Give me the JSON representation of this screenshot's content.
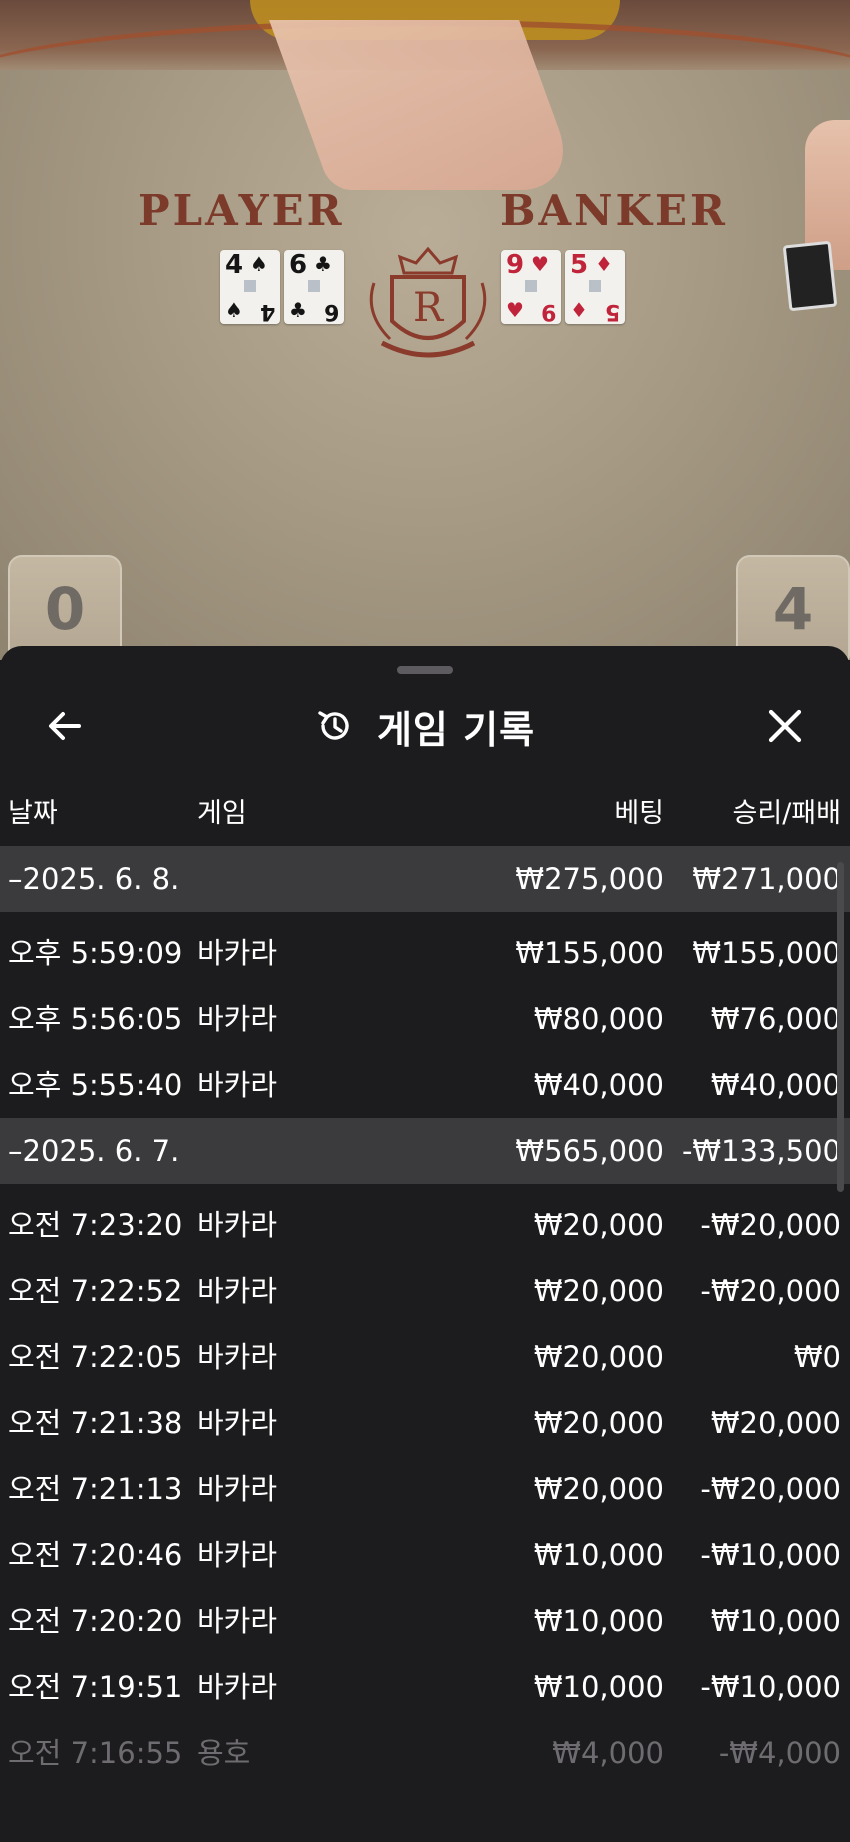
{
  "table": {
    "player_label": "PLAYER",
    "banker_label": "BANKER",
    "crest_letter": "R",
    "player_score": "0",
    "banker_score": "4",
    "player_cards": [
      {
        "rank": "4",
        "suit": "♠",
        "color": "#151515"
      },
      {
        "rank": "6",
        "suit": "♣",
        "color": "#151515"
      }
    ],
    "banker_cards": [
      {
        "rank": "9",
        "suit": "♥",
        "color": "#c0243a"
      },
      {
        "rank": "5",
        "suit": "♦",
        "color": "#c0243a"
      }
    ]
  },
  "sheet": {
    "title": "게임 기록",
    "back_icon": "arrow-left-icon",
    "history_icon": "history-clock-icon",
    "close_icon": "close-icon",
    "columns": {
      "date": "날짜",
      "game": "게임",
      "bet": "베팅",
      "result": "승리/패배"
    },
    "groups": [
      {
        "date": "–2025. 6. 8.",
        "bet": "₩275,000",
        "result": "₩271,000",
        "rows": [
          {
            "time": "오후 5:59:09",
            "game": "바카라",
            "bet": "₩155,000",
            "result": "₩155,000"
          },
          {
            "time": "오후 5:56:05",
            "game": "바카라",
            "bet": "₩80,000",
            "result": "₩76,000"
          },
          {
            "time": "오후 5:55:40",
            "game": "바카라",
            "bet": "₩40,000",
            "result": "₩40,000"
          }
        ]
      },
      {
        "date": "–2025. 6. 7.",
        "bet": "₩565,000",
        "result": "-₩133,500",
        "rows": [
          {
            "time": "오전 7:23:20",
            "game": "바카라",
            "bet": "₩20,000",
            "result": "-₩20,000"
          },
          {
            "time": "오전 7:22:52",
            "game": "바카라",
            "bet": "₩20,000",
            "result": "-₩20,000"
          },
          {
            "time": "오전 7:22:05",
            "game": "바카라",
            "bet": "₩20,000",
            "result": "₩0"
          },
          {
            "time": "오전 7:21:38",
            "game": "바카라",
            "bet": "₩20,000",
            "result": "₩20,000"
          },
          {
            "time": "오전 7:21:13",
            "game": "바카라",
            "bet": "₩20,000",
            "result": "-₩20,000"
          },
          {
            "time": "오전 7:20:46",
            "game": "바카라",
            "bet": "₩10,000",
            "result": "-₩10,000"
          },
          {
            "time": "오전 7:20:20",
            "game": "바카라",
            "bet": "₩10,000",
            "result": "₩10,000"
          },
          {
            "time": "오전 7:19:51",
            "game": "바카라",
            "bet": "₩10,000",
            "result": "-₩10,000"
          },
          {
            "time": "오전 7:16:55",
            "game": "용호",
            "bet": "₩4,000",
            "result": "-₩4,000",
            "faded": true
          }
        ]
      }
    ]
  }
}
